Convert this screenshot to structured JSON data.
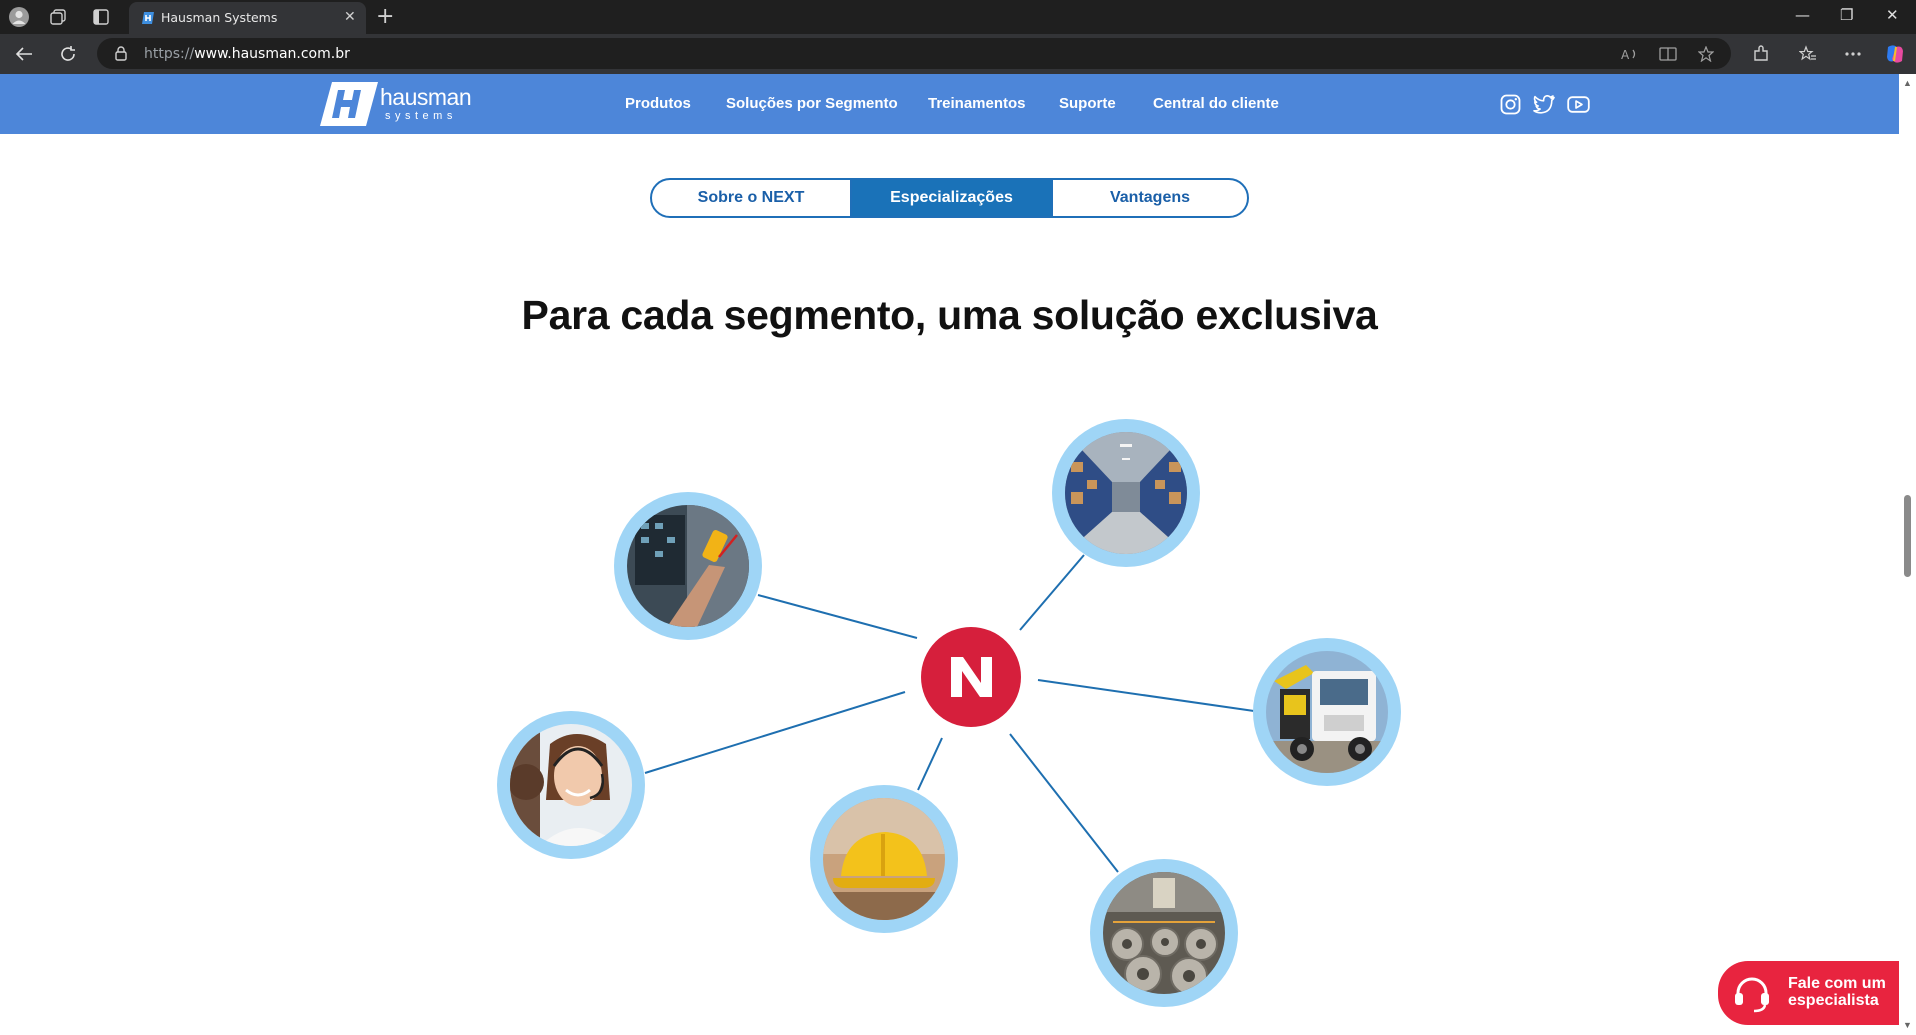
{
  "browser": {
    "tab_title": "Hausman Systems",
    "tab_close": "✕",
    "new_tab": "+",
    "url_scheme": "https://",
    "url_host": "www.hausman.com.br",
    "window_controls": {
      "minimize": "—",
      "restore": "❐",
      "close": "✕"
    }
  },
  "site": {
    "logo_word": "hausman",
    "logo_sub": "systems",
    "logo_letter": "H",
    "menu": [
      "Produtos",
      "Soluções por Segmento",
      "Treinamentos",
      "Suporte",
      "Central do cliente"
    ],
    "social": [
      "instagram-icon",
      "twitter-icon",
      "youtube-icon"
    ]
  },
  "tabs": {
    "items": [
      "Sobre o NEXT",
      "Especializações",
      "Vantagens"
    ],
    "active": "Especializações"
  },
  "headline": "Para cada segmento, uma solução exclusiva",
  "diagram": {
    "hub_letter": "N",
    "nodes": [
      "electrical-technician-photo",
      "warehouse-photo",
      "truck-crane-photo",
      "call-center-agent-photo",
      "hard-hat-photo",
      "steel-coils-factory-photo"
    ]
  },
  "cta": {
    "line1": "Fale com um",
    "line2": "especialista"
  },
  "colors": {
    "header": "#4d86d9",
    "tab_active": "#1a72b8",
    "hub": "#d61f3c",
    "node_ring": "#9fd5f6",
    "link_line": "#1e6fb0",
    "cta": "#e8243f"
  }
}
